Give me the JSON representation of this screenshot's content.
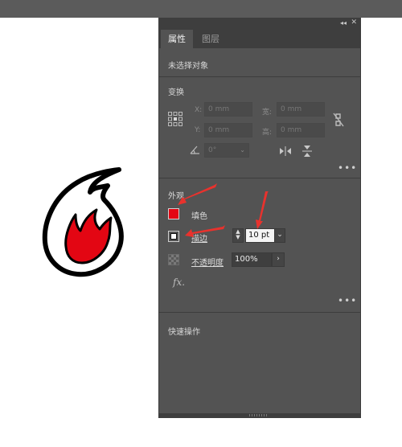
{
  "panel": {
    "tabs": [
      {
        "label": "属性",
        "active": true
      },
      {
        "label": "图层",
        "active": false
      }
    ],
    "status": "未选择对象",
    "transform": {
      "title": "变换",
      "x_label": "X:",
      "x_value": "0 mm",
      "y_label": "Y:",
      "y_value": "0 mm",
      "w_label": "宽:",
      "w_value": "0 mm",
      "h_label": "高:",
      "h_value": "0 mm",
      "angle_value": "0°"
    },
    "appearance": {
      "title": "外观",
      "fill_label": "填色",
      "fill_color": "#e30613",
      "stroke_label": "描边",
      "stroke_value": "10 pt",
      "opacity_label": "不透明度",
      "opacity_value": "100%",
      "fx_label": "fx."
    },
    "quick_actions": {
      "title": "快速操作"
    }
  },
  "annotations": {
    "arrow_color": "#e8322d"
  },
  "artwork": {
    "fill_color": "#e30613",
    "stroke_color": "#000000"
  }
}
